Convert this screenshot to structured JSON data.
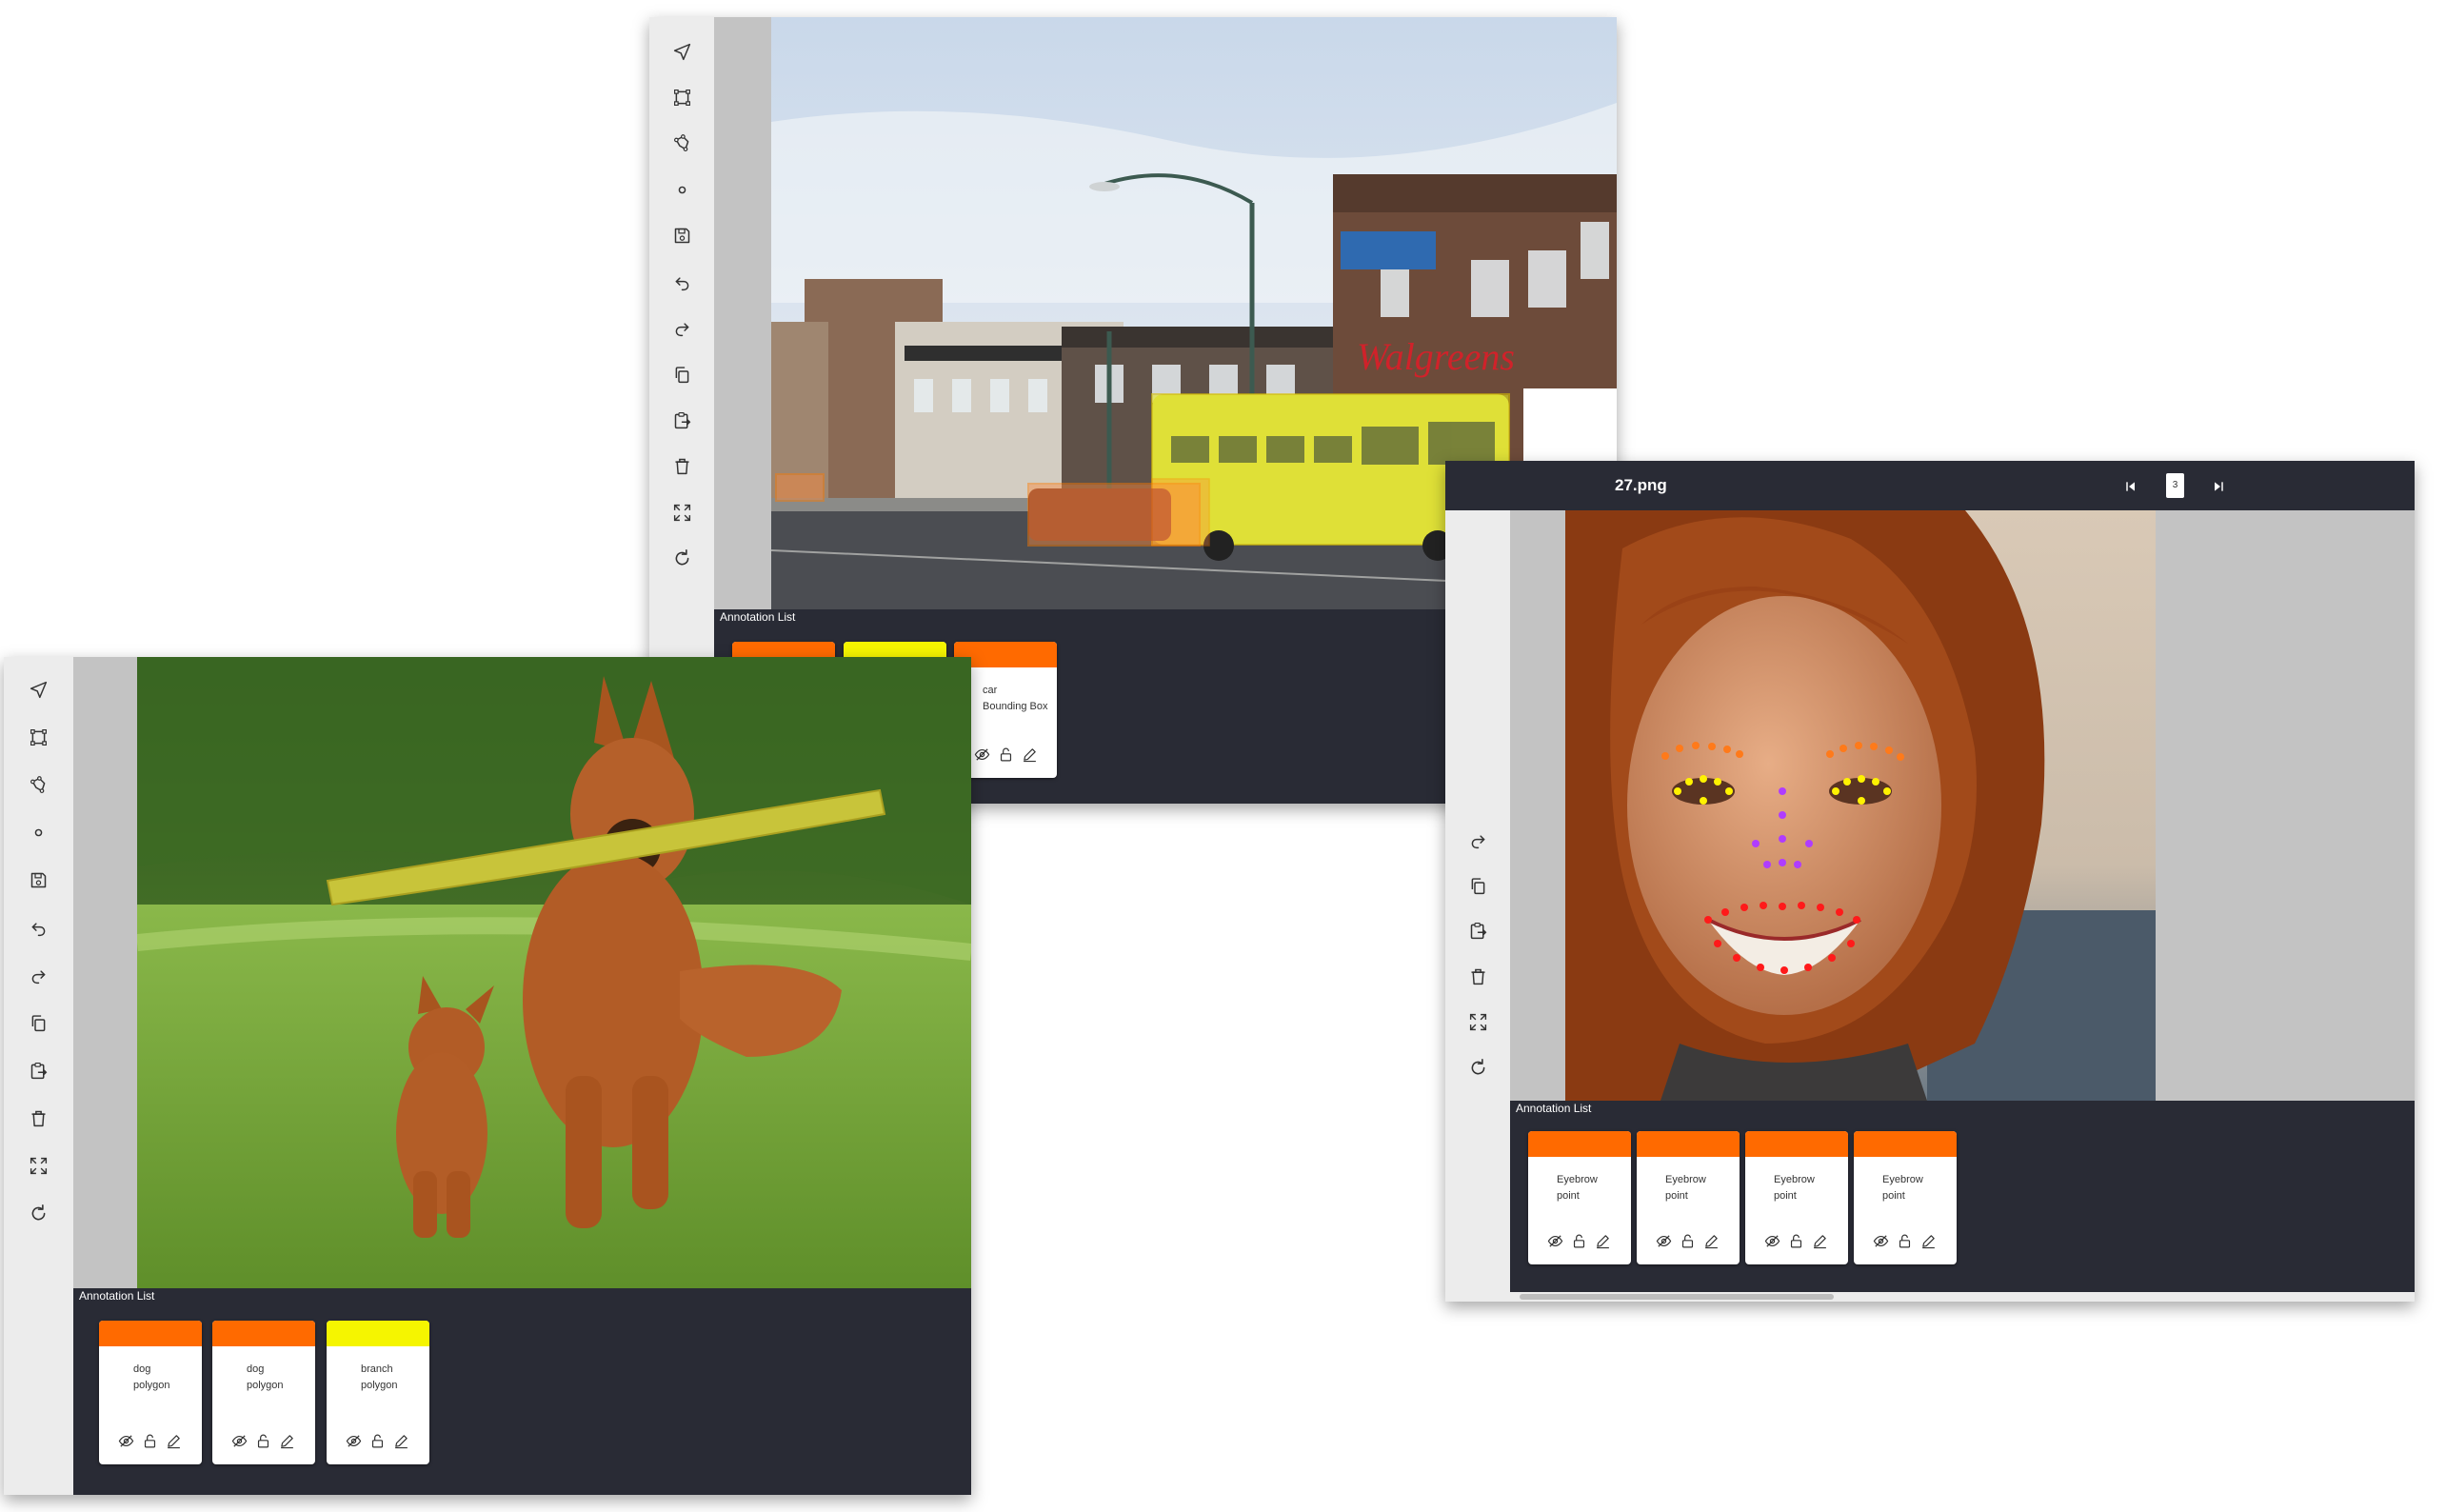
{
  "windows": {
    "street": {
      "panel_title": "Annotation List",
      "cards": [
        {
          "color": "#ff6a00",
          "label": "",
          "type": ""
        },
        {
          "color": "#f5f500",
          "label": "",
          "type": ""
        },
        {
          "color": "#ff6a00",
          "label": "car",
          "type": "Bounding Box"
        }
      ]
    },
    "face": {
      "filename": "27.png",
      "page_number": "3",
      "panel_title": "Annotation List",
      "cards": [
        {
          "color": "#ff6a00",
          "label": "Eyebrow",
          "type": "point"
        },
        {
          "color": "#ff6a00",
          "label": "Eyebrow",
          "type": "point"
        },
        {
          "color": "#ff6a00",
          "label": "Eyebrow",
          "type": "point"
        },
        {
          "color": "#ff6a00",
          "label": "Eyebrow",
          "type": "point"
        }
      ]
    },
    "dogs": {
      "panel_title": "Annotation List",
      "cards": [
        {
          "color": "#ff6a00",
          "label": "dog",
          "type": "polygon"
        },
        {
          "color": "#ff6a00",
          "label": "dog",
          "type": "polygon"
        },
        {
          "color": "#f5f500",
          "label": "branch",
          "type": "polygon"
        }
      ]
    }
  },
  "toolbar_icons": [
    "pointer-icon",
    "rectangle-icon",
    "polygon-icon",
    "point-icon",
    "save-icon",
    "undo-icon",
    "redo-icon",
    "copy-icon",
    "paste-icon",
    "delete-icon",
    "fit-screen-icon",
    "reset-icon"
  ]
}
